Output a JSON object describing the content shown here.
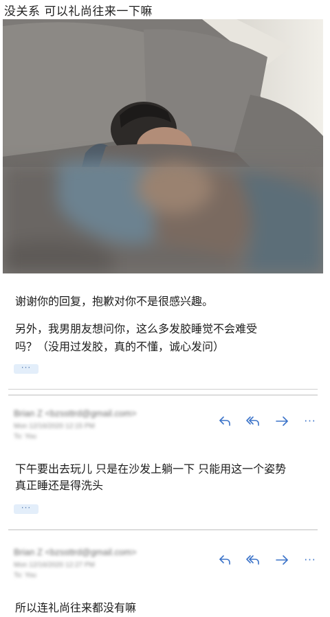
{
  "caption": "没关系 可以礼尚往来一下嘛",
  "colors": {
    "accent": "#3b73c9",
    "more_bg": "#e3eefa",
    "divider": "#cfcfcf"
  },
  "message1": {
    "line1": "谢谢你的回复，抱歉对你不是很感兴趣。",
    "line2": "另外，我男朋友想问你，这么多发胶睡觉不会难受",
    "line3": "吗？（没用过发胶，真的不懂，诚心发问）",
    "more": "···"
  },
  "email1": {
    "sender": "Brian Z <bzssttrd@gmail.com>",
    "date": "Mon 12/16/2020 12:15 PM",
    "to": "To: You",
    "body_line1": "下午要出去玩儿 只是在沙发上躺一下 只能用这一个姿势",
    "body_line2": "真正睡还是得洗头",
    "more": "···"
  },
  "email2": {
    "sender": "Brian Z <bzssttrd@gmail.com>",
    "date": "Mon 12/16/2020 12:27 PM",
    "to": "To: You",
    "body_line1": "所以连礼尚往来都没有嘛"
  },
  "actions": {
    "reply_icon": "reply-icon",
    "reply_all_icon": "reply-all-icon",
    "forward_icon": "forward-icon",
    "more_label": "···"
  }
}
